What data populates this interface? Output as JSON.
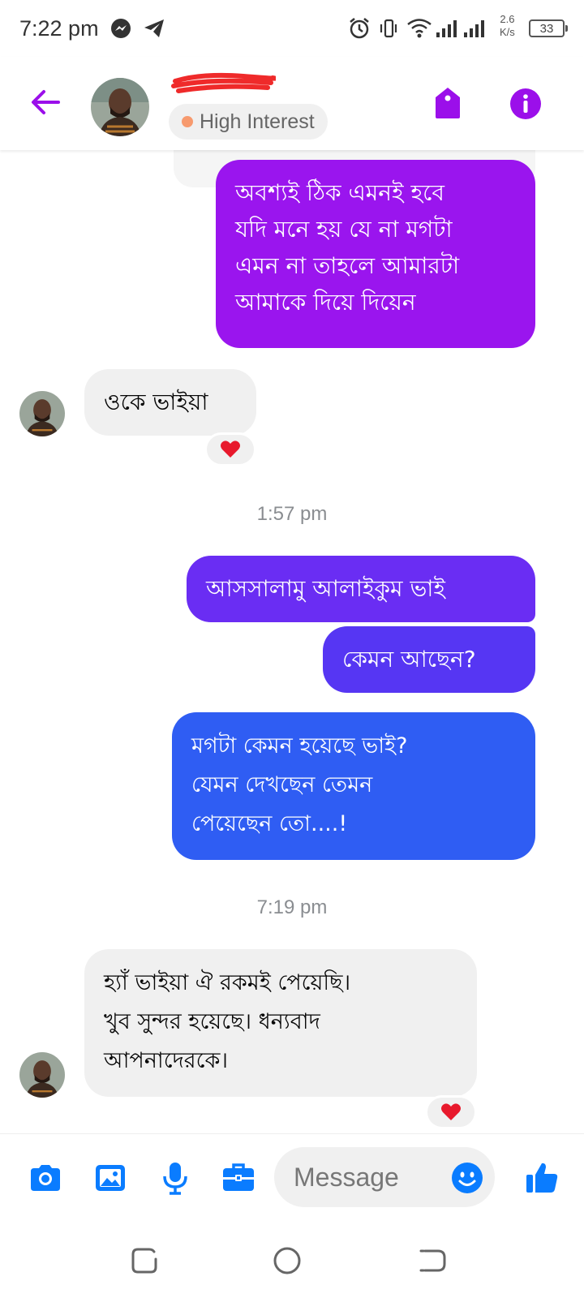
{
  "status_bar": {
    "time": "7:22 pm",
    "net_speed_value": "2.6",
    "net_speed_unit": "K/s",
    "battery": "33"
  },
  "header": {
    "contact_name": "",
    "interest_label": "High Interest",
    "interest_dot_color": "#f79a6e",
    "accent_color": "#9b0fea"
  },
  "messages": [
    {
      "dir": "out",
      "color": "#9a15ee",
      "text_lines": [
        "অবশ্যই ঠিক এমনই হবে",
        "যদি মনে হয় যে না মগটা",
        "এমন না তাহলে আমারটা",
        "আমাকে দিয়ে দিয়েন"
      ]
    },
    {
      "dir": "in",
      "text_lines": [
        "ওকে ভাইয়া"
      ],
      "reaction": "heart"
    },
    {
      "type": "time",
      "text": "1:57 pm"
    },
    {
      "dir": "out",
      "color": "#6a2df3",
      "text_lines": [
        "আসসালামু আলাইকুম ভাই"
      ]
    },
    {
      "dir": "out",
      "color": "#5636f3",
      "text_lines": [
        "কেমন আছেন?"
      ]
    },
    {
      "dir": "out",
      "color": "#2f5df3",
      "text_lines": [
        "মগটা কেমন হয়েছে ভাই?",
        "যেমন দেখছেন তেমন",
        "পেয়েছেন তো....!"
      ]
    },
    {
      "type": "time",
      "text": "7:19 pm"
    },
    {
      "dir": "in",
      "text_lines": [
        "হ্যাঁ ভাইয়া ঐ রকমই পেয়েছি।",
        "খুব সুন্দর হয়েছে। ধন্যবাদ",
        "আপনাদেরকে।"
      ],
      "reaction": "heart"
    }
  ],
  "composer": {
    "placeholder": "Message",
    "icon_color": "#0a7cff",
    "icons": [
      "camera-icon",
      "gallery-icon",
      "microphone-icon",
      "briefcase-icon",
      "emoji-icon",
      "thumbs-up-icon"
    ]
  },
  "nav_bar": {
    "icons": [
      "recents-icon",
      "home-icon",
      "back-icon"
    ]
  }
}
